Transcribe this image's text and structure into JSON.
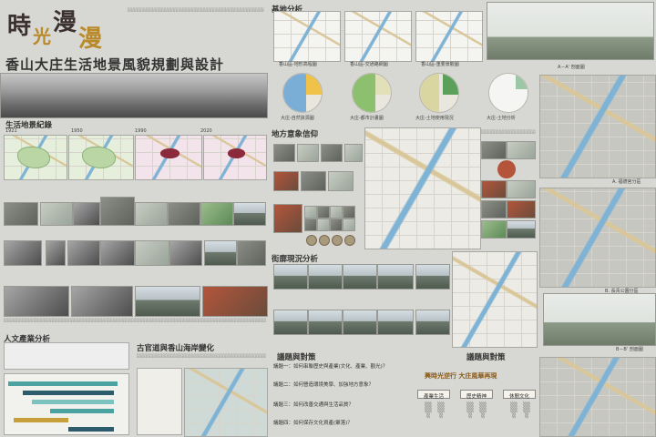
{
  "header": {
    "title_a": "時",
    "title_b": "光",
    "title_c": "漫",
    "title_d": "漫",
    "subtitle": "香山大庄生活地景風貌規劃與設計"
  },
  "sections": {
    "life_change": "生活地景紀錄",
    "years": [
      "1921",
      "1950",
      "1990",
      "2020"
    ],
    "people": "人文產業分析",
    "coast": "古官道與香山海岸變化",
    "base": "基地分析",
    "local_belief": "地方意象信仰",
    "street": "街廓現況分析",
    "issue": "議題與對策",
    "vision": "議題與對策",
    "vision_slogan": "興時光逆行 大庄風華再現",
    "vision_items": [
      "產業生活",
      "歷史精神",
      "休閒文化"
    ]
  },
  "base_captions": [
    "香山區-地形高程圖",
    "香山區-交通路網圖",
    "香山區-重要景觀圖",
    "大庄-自然資源圖",
    "大庄-都市計畫圖",
    "大庄-土地使用現況",
    "大庄-土地分析"
  ],
  "right_captions": {
    "section_aa": "A－A' 剖面圖",
    "plan_a": "A. 福德宮分區",
    "plan_b": "B. 長青公園分區",
    "section_bb": "B－B' 剖面圖"
  },
  "issues": [
    "議題一：如何串聯歷史與產業(文化、產業、觀光)？",
    "議題二：如何營造環境美學、加強地方意象？",
    "議題三：如何改善交通與生活品質？",
    "議題四：如何保存文化資產(聚落)？"
  ],
  "palette": {
    "bg": "#d7d7d3",
    "accent": "#b98a2a",
    "timeline_teal": "#4aa3a1",
    "timeline_dark": "#2c5b6b"
  }
}
